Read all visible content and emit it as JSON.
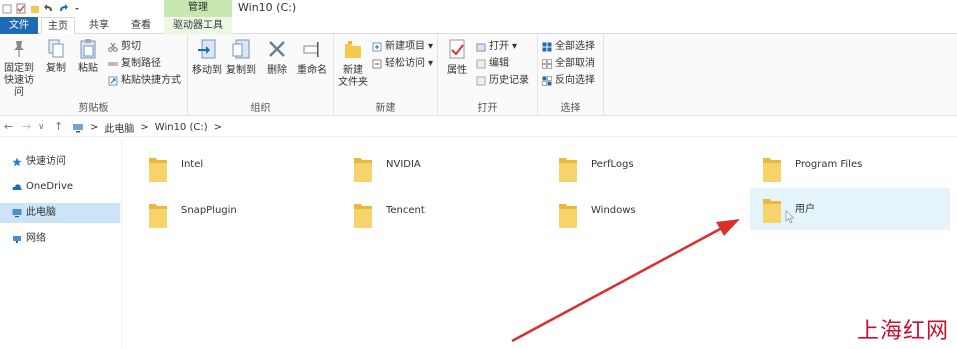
{
  "window": {
    "title": "Win10 (C:)",
    "manage_label": "管理"
  },
  "tabs": [
    {
      "label": "文件"
    },
    {
      "label": "主页"
    },
    {
      "label": "共享"
    },
    {
      "label": "查看"
    },
    {
      "label": "驱动器工具"
    }
  ],
  "ribbon": {
    "clipboard": {
      "label": "剪贴板",
      "pin": "固定到\n快速访问",
      "pin_l1": "固定到",
      "pin_l2": "快速访问",
      "copy": "复制",
      "paste": "粘贴",
      "cut": "剪切",
      "copy_path": "复制路径",
      "paste_shortcut": "粘贴快捷方式"
    },
    "organize": {
      "label": "组织",
      "move_to": "移动到",
      "copy_to": "复制到",
      "delete": "删除",
      "rename": "重命名"
    },
    "new": {
      "label": "新建",
      "new_folder_l1": "新建",
      "new_folder_l2": "文件夹",
      "new_item": "新建项目",
      "easy_access": "轻松访问"
    },
    "open": {
      "label": "打开",
      "properties": "属性",
      "open": "打开",
      "edit": "编辑",
      "history": "历史记录"
    },
    "select": {
      "label": "选择",
      "select_all": "全部选择",
      "select_none": "全部取消",
      "invert": "反向选择"
    }
  },
  "address": {
    "crumbs": [
      "此电脑",
      "Win10 (C:)"
    ],
    "sep": ">"
  },
  "sidebar": {
    "items": [
      {
        "label": "快速访问",
        "selected": false
      },
      {
        "label": "OneDrive",
        "selected": false
      },
      {
        "label": "此电脑",
        "selected": true
      },
      {
        "label": "网络",
        "selected": false
      }
    ]
  },
  "folders": [
    {
      "name": "Intel"
    },
    {
      "name": "NVIDIA"
    },
    {
      "name": "PerfLogs"
    },
    {
      "name": "Program Files"
    },
    {
      "name": "SnapPlugin"
    },
    {
      "name": "Tencent"
    },
    {
      "name": "Windows"
    },
    {
      "name": "用户",
      "highlighted": true
    }
  ],
  "watermark": "上海红网",
  "colors": {
    "file_tab": "#1e6bb5",
    "manage_tab": "#c7e8b0",
    "folder": "#f5c94a",
    "selection": "#cce4f7",
    "arrow": "#d9302c"
  }
}
